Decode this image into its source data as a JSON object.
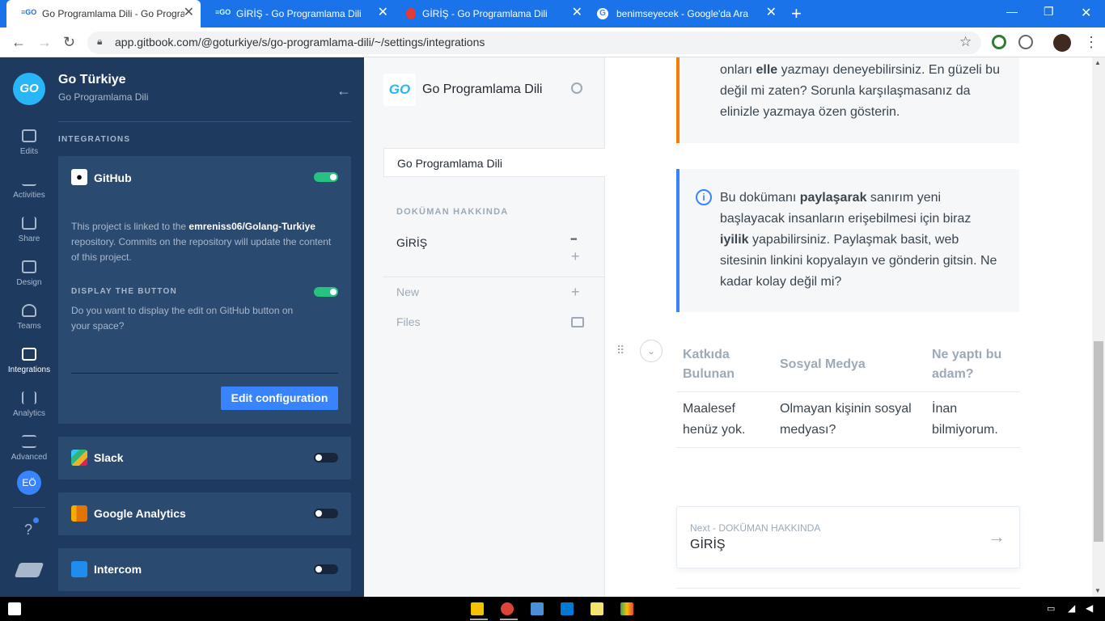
{
  "browser": {
    "tabs": [
      {
        "title": "Go Programlama Dili - Go Progra",
        "active": true
      },
      {
        "title": "GİRİŞ - Go Programlama Dili",
        "active": false
      },
      {
        "title": "GİRİŞ - Go Programlama Dili",
        "active": false
      },
      {
        "title": "benimseyecek - Google'da Ara",
        "active": false
      }
    ],
    "new_tab": "+",
    "close": "✕",
    "url": "app.gitbook.com/@goturkiye/s/go-programlama-dili/~/settings/integrations",
    "avatar_initials": ""
  },
  "org": {
    "name": "Go Türkiye",
    "space": "Go Programlama Dili",
    "logo_text": "GO"
  },
  "rail": {
    "items": [
      {
        "label": "Edits",
        "icon": "edit-icon"
      },
      {
        "label": "Activities",
        "icon": "activity-icon"
      },
      {
        "label": "Share",
        "icon": "share-icon"
      },
      {
        "label": "Design",
        "icon": "paint-roller-icon"
      },
      {
        "label": "Teams",
        "icon": "users-icon"
      },
      {
        "label": "Integrations",
        "icon": "puzzle-icon",
        "active": true
      },
      {
        "label": "Analytics",
        "icon": "bar-chart-icon"
      },
      {
        "label": "Advanced",
        "icon": "sliders-icon"
      }
    ],
    "user_initials": "EÖ",
    "help": "?"
  },
  "integrations": {
    "heading": "INTEGRATIONS",
    "github": {
      "name": "GitHub",
      "enabled": true,
      "desc_before": "This project is linked to the ",
      "repo": "emreniss06/Golang-Turkiye",
      "desc_after": " repository. Commits on the repository will update the content of this project.",
      "display_heading": "DISPLAY THE BUTTON",
      "display_enabled": true,
      "display_desc": "Do you want to display the edit on GitHub button on your space?",
      "edit_button": "Edit configuration"
    },
    "others": [
      {
        "name": "Slack",
        "enabled": false
      },
      {
        "name": "Google Analytics",
        "enabled": false
      },
      {
        "name": "Intercom",
        "enabled": false
      }
    ],
    "colors": {
      "toggle_on": "#26c281",
      "toggle_off": "#17263a",
      "button": "#3884ff"
    }
  },
  "nav": {
    "title": "Go Programlama Dili",
    "variant": "Go Programlama Dili",
    "section": "DOKÜMAN HAKKINDA",
    "page": "GİRİŞ",
    "more": "•••",
    "new_label": "New",
    "files_label": "Files",
    "plus": "+"
  },
  "content": {
    "warning_lines": [
      [
        "onları ",
        "elle",
        " yazmayı deneyebilirsiniz. En güzeli bu"
      ],
      [
        "değil mi zaten? Sorunla karşılaşmasanız da"
      ],
      [
        "elinizle yazmaya özen gösterin."
      ]
    ],
    "info": {
      "p1a": "Bu dokümanı ",
      "p1b": "paylaşarak",
      "p1c": " sanırım yeni",
      "l2": "başlayacak insanların erişebilmesi için biraz",
      "l3a": "iyilik",
      "l3b": " yapabilirsiniz. Paylaşmak basit, web",
      "l4": "sitesinin linkini kopyalayın ve gönderin gitsin. Ne",
      "l5": "kadar kolay değil mi?"
    },
    "table": {
      "headers": [
        "Katkıda Bulunan",
        "Sosyal Medya",
        "Ne yaptı bu adam?"
      ],
      "rows": [
        [
          "Maalesef henüz yok.",
          "Olmayan kişinin sosyal medyası?",
          "İnan bilmiyorum."
        ]
      ]
    },
    "next": {
      "label": "Next - DOKÜMAN HAKKINDA",
      "title": "GİRİŞ"
    }
  }
}
